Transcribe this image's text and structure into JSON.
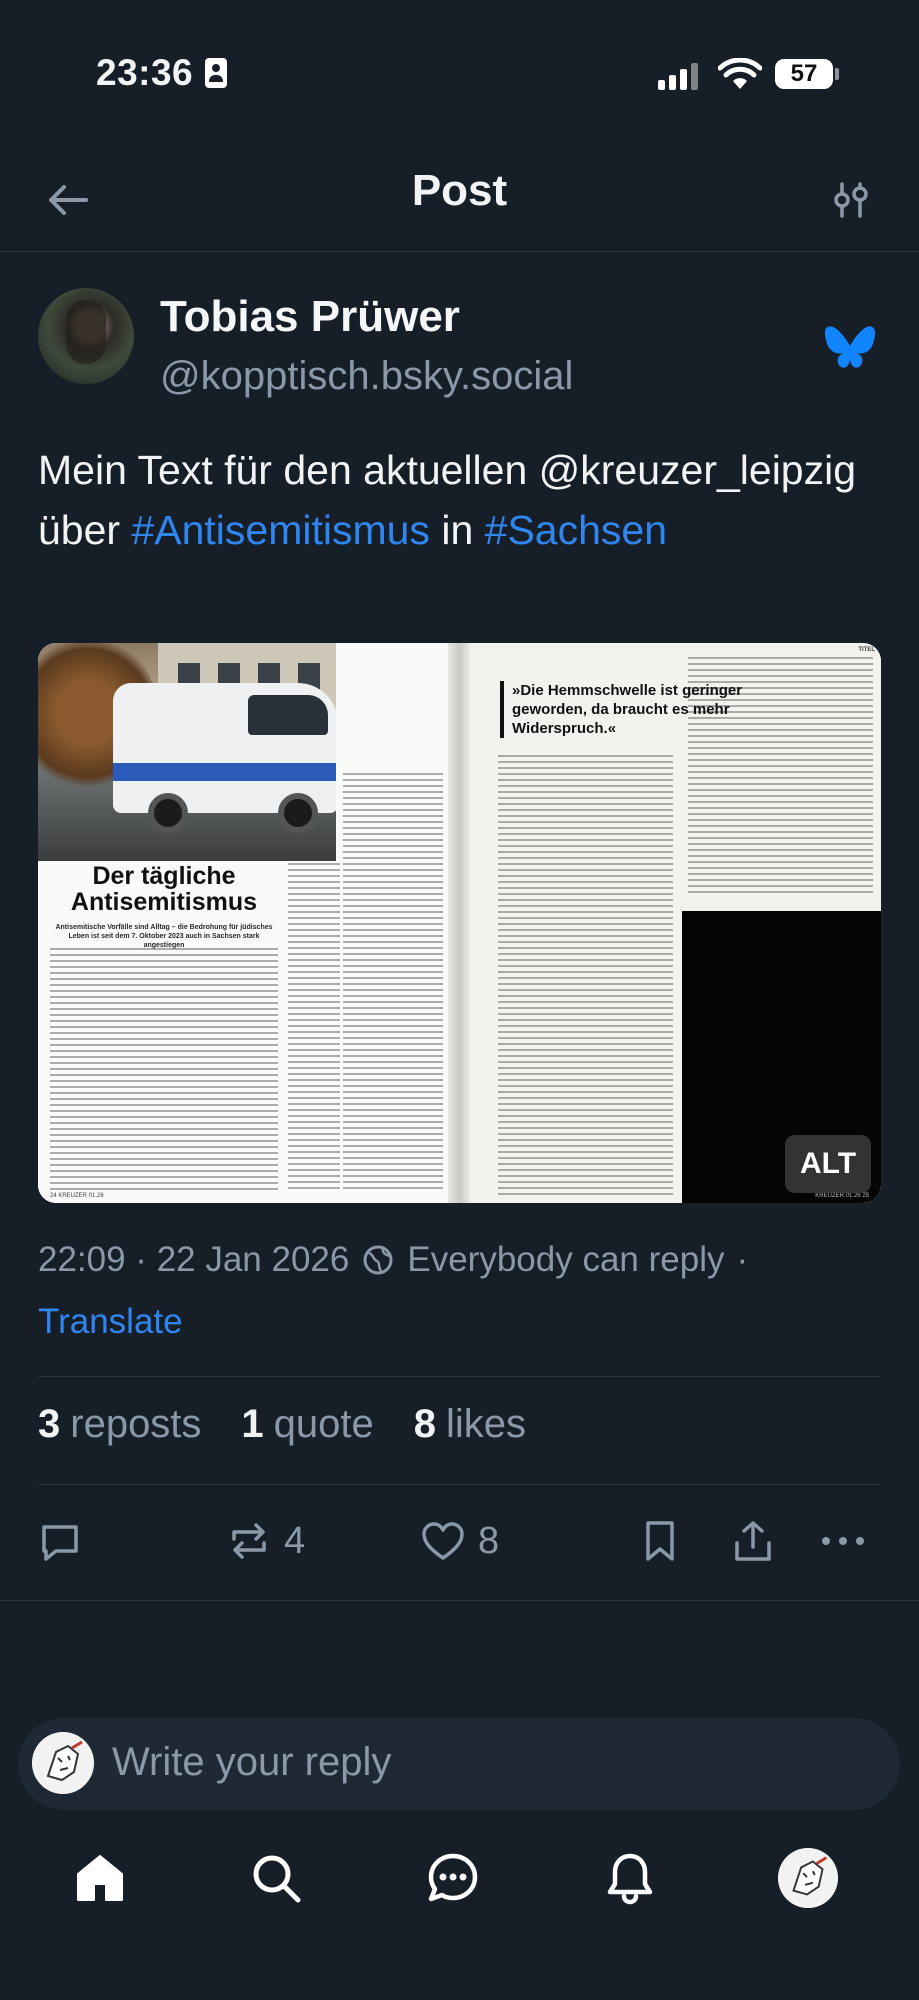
{
  "status_bar": {
    "time": "23:36",
    "battery": "57"
  },
  "header": {
    "title": "Post"
  },
  "post": {
    "author_name": "Tobias Prüwer",
    "author_handle": "@kopptisch.bsky.social",
    "text_parts": [
      "Mein Text für den aktuellen @kreuzer_leipzig über ",
      "#Antisemitismus",
      " in ",
      "#Sachsen"
    ],
    "image": {
      "article_headline": "Der tägliche Antisemitismus",
      "article_subhead": "Antisemitische Vorfälle sind Alltag – die Bedrohung für jüdisches Leben ist seit dem 7. Oktober 2023 auch in Sachsen stark angestiegen",
      "pull_quote": "»Die Hemmschwelle ist geringer geworden, da braucht es mehr Widerspruch.«",
      "section_tag": "TITEL",
      "footer_left": "24   KREUZER 01.26",
      "footer_right": "KREUZER 01.26   25",
      "alt_badge": "ALT"
    },
    "timestamp": "22:09 · 22 Jan 2026",
    "reply_setting": "Everybody can reply",
    "meta_separator": "·",
    "translate_label": "Translate"
  },
  "stats": {
    "reposts_count": "3",
    "reposts_label": "reposts",
    "quotes_count": "1",
    "quotes_label": "quote",
    "likes_count": "8",
    "likes_label": "likes"
  },
  "actions": {
    "repost_count": "4",
    "like_count": "8"
  },
  "reply": {
    "placeholder": "Write your reply"
  },
  "colors": {
    "background": "#161e27",
    "accent": "#2f86f0",
    "muted": "#8b98a7",
    "bluesky": "#1185fe"
  },
  "icons": [
    "back-arrow-icon",
    "sliders-icon",
    "butterfly-icon",
    "globe-icon",
    "comment-icon",
    "repost-icon",
    "heart-icon",
    "bookmark-icon",
    "share-icon",
    "more-icon",
    "home-icon",
    "search-icon",
    "chat-icon",
    "bell-icon"
  ]
}
